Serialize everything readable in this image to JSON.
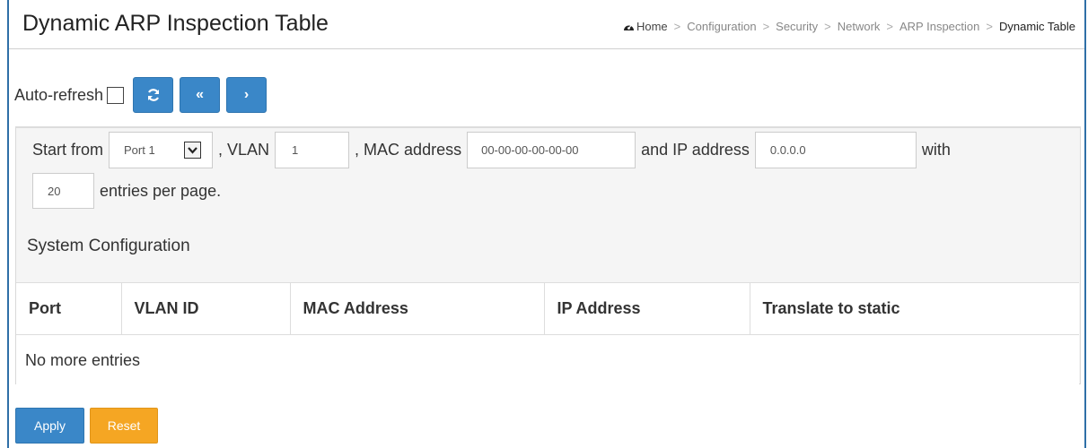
{
  "header": {
    "title": "Dynamic ARP Inspection Table",
    "breadcrumb": [
      "Home",
      "Configuration",
      "Security",
      "Network",
      "ARP Inspection",
      "Dynamic Table"
    ]
  },
  "toolbar": {
    "auto_refresh_label": "Auto-refresh",
    "auto_refresh_checked": false,
    "refresh_icon": "refresh-icon",
    "first_page_glyph": "«",
    "next_page_glyph": "›"
  },
  "filter": {
    "start_from_label": "Start from",
    "port_value": "Port 1",
    "vlan_label": ", VLAN",
    "vlan_value": "1",
    "mac_label": ", MAC address",
    "mac_value": "00-00-00-00-00-00",
    "ip_label": "and IP address",
    "ip_value": "0.0.0.0",
    "with_label": "with",
    "entries_value": "20",
    "entries_label": "entries per page."
  },
  "section": {
    "title": "System Configuration"
  },
  "table": {
    "columns": [
      "Port",
      "VLAN ID",
      "MAC Address",
      "IP Address",
      "Translate to static"
    ],
    "empty_text": "No more entries"
  },
  "actions": {
    "apply_label": "Apply",
    "reset_label": "Reset"
  },
  "colors": {
    "primary": "#3a87c8",
    "reset": "#f5a623",
    "frame": "#2f6fa7"
  }
}
